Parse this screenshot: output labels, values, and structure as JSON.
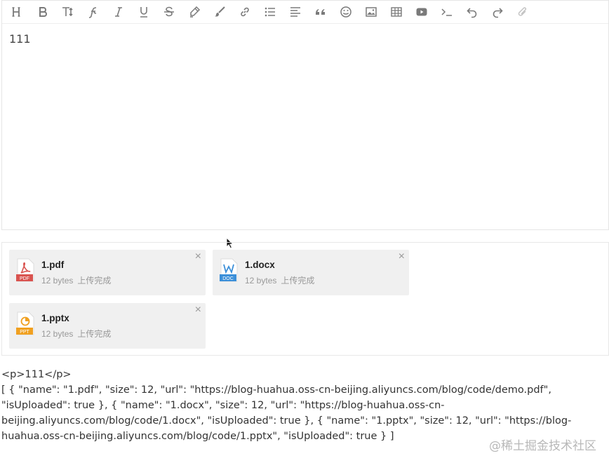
{
  "editor": {
    "toolbar": [
      {
        "name": "heading-icon"
      },
      {
        "name": "bold-icon"
      },
      {
        "name": "font-size-icon"
      },
      {
        "name": "font-family-icon"
      },
      {
        "name": "italic-icon"
      },
      {
        "name": "underline-icon"
      },
      {
        "name": "strikethrough-icon"
      },
      {
        "name": "highlight-icon"
      },
      {
        "name": "brush-icon"
      },
      {
        "name": "link-icon"
      },
      {
        "name": "list-icon"
      },
      {
        "name": "align-icon"
      },
      {
        "name": "quote-icon"
      },
      {
        "name": "emoji-icon"
      },
      {
        "name": "image-icon"
      },
      {
        "name": "table-icon"
      },
      {
        "name": "video-icon"
      },
      {
        "name": "code-icon"
      },
      {
        "name": "undo-icon"
      },
      {
        "name": "redo-icon"
      },
      {
        "name": "attachment-icon"
      }
    ],
    "content": "111"
  },
  "files": [
    {
      "name": "1.pdf",
      "size": "12 bytes",
      "status": "上传完成",
      "badge": "PDF",
      "icon": "pdf-file-icon",
      "color": "#d9534f"
    },
    {
      "name": "1.docx",
      "size": "12 bytes",
      "status": "上传完成",
      "badge": "DOC",
      "icon": "doc-file-icon",
      "color": "#3b8fd9"
    },
    {
      "name": "1.pptx",
      "size": "12 bytes",
      "status": "上传完成",
      "badge": "PPT",
      "icon": "ppt-file-icon",
      "color": "#f0a020"
    }
  ],
  "output": {
    "html": "<p>111</p>",
    "json": "[ { \"name\": \"1.pdf\", \"size\": 12, \"url\": \"https://blog-huahua.oss-cn-beijing.aliyuncs.com/blog/code/demo.pdf\", \"isUploaded\": true }, { \"name\": \"1.docx\", \"size\": 12, \"url\": \"https://blog-huahua.oss-cn-beijing.aliyuncs.com/blog/code/1.docx\", \"isUploaded\": true }, { \"name\": \"1.pptx\", \"size\": 12, \"url\": \"https://blog-huahua.oss-cn-beijing.aliyuncs.com/blog/code/1.pptx\", \"isUploaded\": true } ]"
  },
  "watermark": "@稀土掘金技术社区"
}
